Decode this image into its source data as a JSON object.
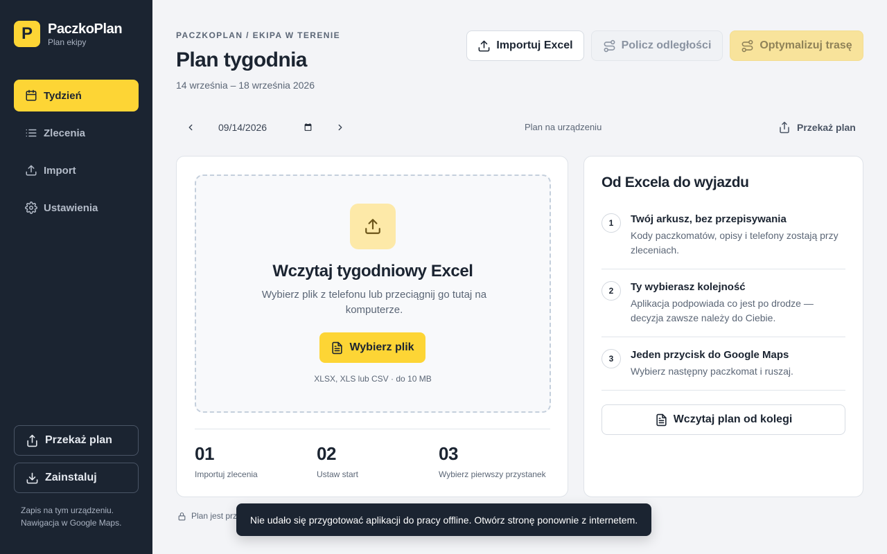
{
  "app": {
    "logo_letter": "P",
    "name": "PaczkoPlan",
    "subtitle": "Plan ekipy"
  },
  "colors": {
    "accent": "#fdd535",
    "sidebar": "#1b2431",
    "background": "#f3f4f7"
  },
  "sidebar": {
    "items": [
      {
        "label": "Tydzień",
        "icon": "calendar-icon",
        "active": true
      },
      {
        "label": "Zlecenia",
        "icon": "list-icon",
        "active": false
      },
      {
        "label": "Import",
        "icon": "upload-icon",
        "active": false
      },
      {
        "label": "Ustawienia",
        "icon": "gear-icon",
        "active": false
      }
    ],
    "share_label": "Przekaż plan",
    "install_label": "Zainstaluj",
    "note": "Zapis na tym urządzeniu. Nawigacja w Google Maps."
  },
  "header": {
    "breadcrumb": "PACZKOPLAN / EKIPA W TERENIE",
    "title": "Plan tygodnia",
    "date_range": "14 września – 18 września 2026",
    "import_label": "Importuj Excel",
    "distance_label": "Policz odległości",
    "optimize_label": "Optymalizuj trasę"
  },
  "toolbar": {
    "date_value": "09/14/2026",
    "device_label": "Plan na urządzeniu",
    "share_label": "Przekaż plan"
  },
  "upload": {
    "title": "Wczytaj tygodniowy Excel",
    "description": "Wybierz plik z telefonu lub przeciągnij go tutaj na komputerze.",
    "button_label": "Wybierz plik",
    "formats": "XLSX, XLS lub CSV · do 10 MB",
    "steps": [
      {
        "num": "01",
        "label": "Importuj zlecenia"
      },
      {
        "num": "02",
        "label": "Ustaw start"
      },
      {
        "num": "03",
        "label": "Wybierz pierwszy przystanek"
      }
    ]
  },
  "guide": {
    "title": "Od Excela do wyjazdu",
    "items": [
      {
        "num": "1",
        "title": "Twój arkusz, bez przepisywania",
        "desc": "Kody paczkomatów, opisy i telefony zostają przy zleceniach."
      },
      {
        "num": "2",
        "title": "Ty wybierasz kolejność",
        "desc": "Aplikacja podpowiada co jest po drodze — decyzja zawsze należy do Ciebie."
      },
      {
        "num": "3",
        "title": "Jeden przycisk do Google Maps",
        "desc": "Wybierz następny paczkomat i ruszaj."
      }
    ],
    "load_label": "Wczytaj plan od kolegi"
  },
  "footer": {
    "note": "Plan jest prz"
  },
  "toast": {
    "message": "Nie udało się przygotować aplikacji do pracy offline. Otwórz stronę ponownie z internetem."
  }
}
